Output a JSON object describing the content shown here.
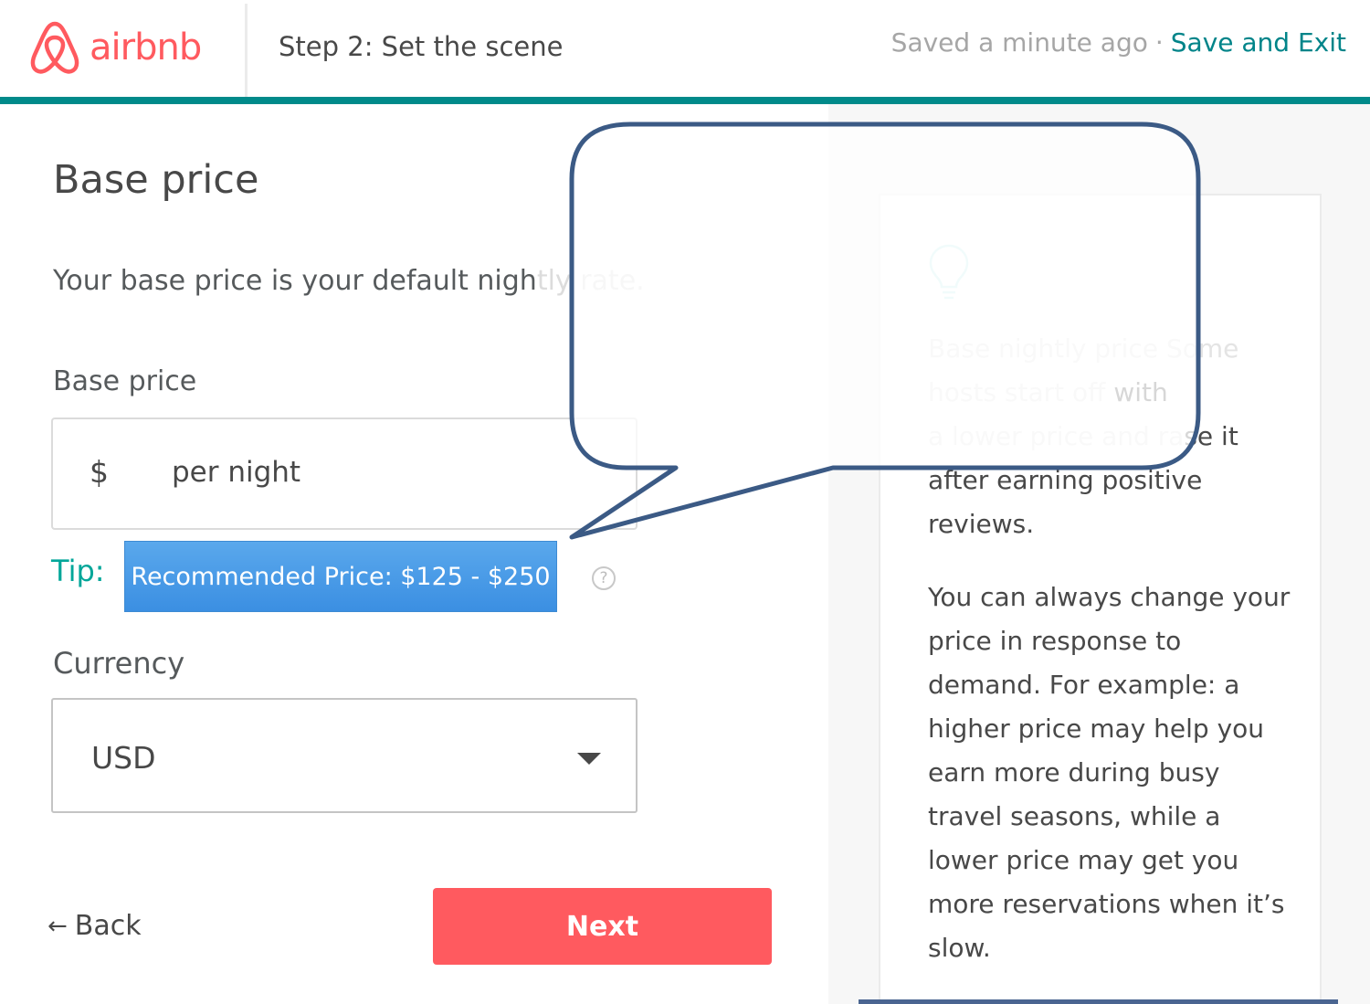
{
  "header": {
    "logo_text": "airbnb",
    "step_title": "Step 2: Set the scene",
    "saved_status": "Saved a minute ago",
    "separator": "·",
    "save_exit_label": "Save and Exit"
  },
  "main": {
    "title": "Base price",
    "description_visible": "Your base price is your default nigh",
    "description_faded": "tly rate.",
    "base_price_label": "Base price",
    "currency_symbol": "$",
    "price_unit": "per night",
    "tip_label": "Tip:",
    "recommended_price": "Recommended Price: $125 - $250",
    "help_icon_glyph": "?",
    "currency_label": "Currency",
    "currency_value": "USD",
    "back_label": "Back",
    "back_arrow": "←",
    "next_label": "Next"
  },
  "tip_card": {
    "icon": "lightbulb-icon",
    "p1_faded": "Base nightly price Some hosts start off",
    "p1_faded_cont": "a lower price and ra",
    "p1_line2_tail": "with",
    "p1_line3_tail": "se it",
    "p1_rest": "after earning positive reviews.",
    "p2": "You can always change your price in response to demand. For example: a higher price may help you earn more during busy travel seasons, while a lower price may get you more reservations when it’s slow."
  },
  "colors": {
    "brand": "#ff5a5f",
    "teal": "#008489",
    "header_bar": "#008a8a",
    "tip_button": "#4a9de8",
    "callout_stroke": "#3b5a85"
  }
}
